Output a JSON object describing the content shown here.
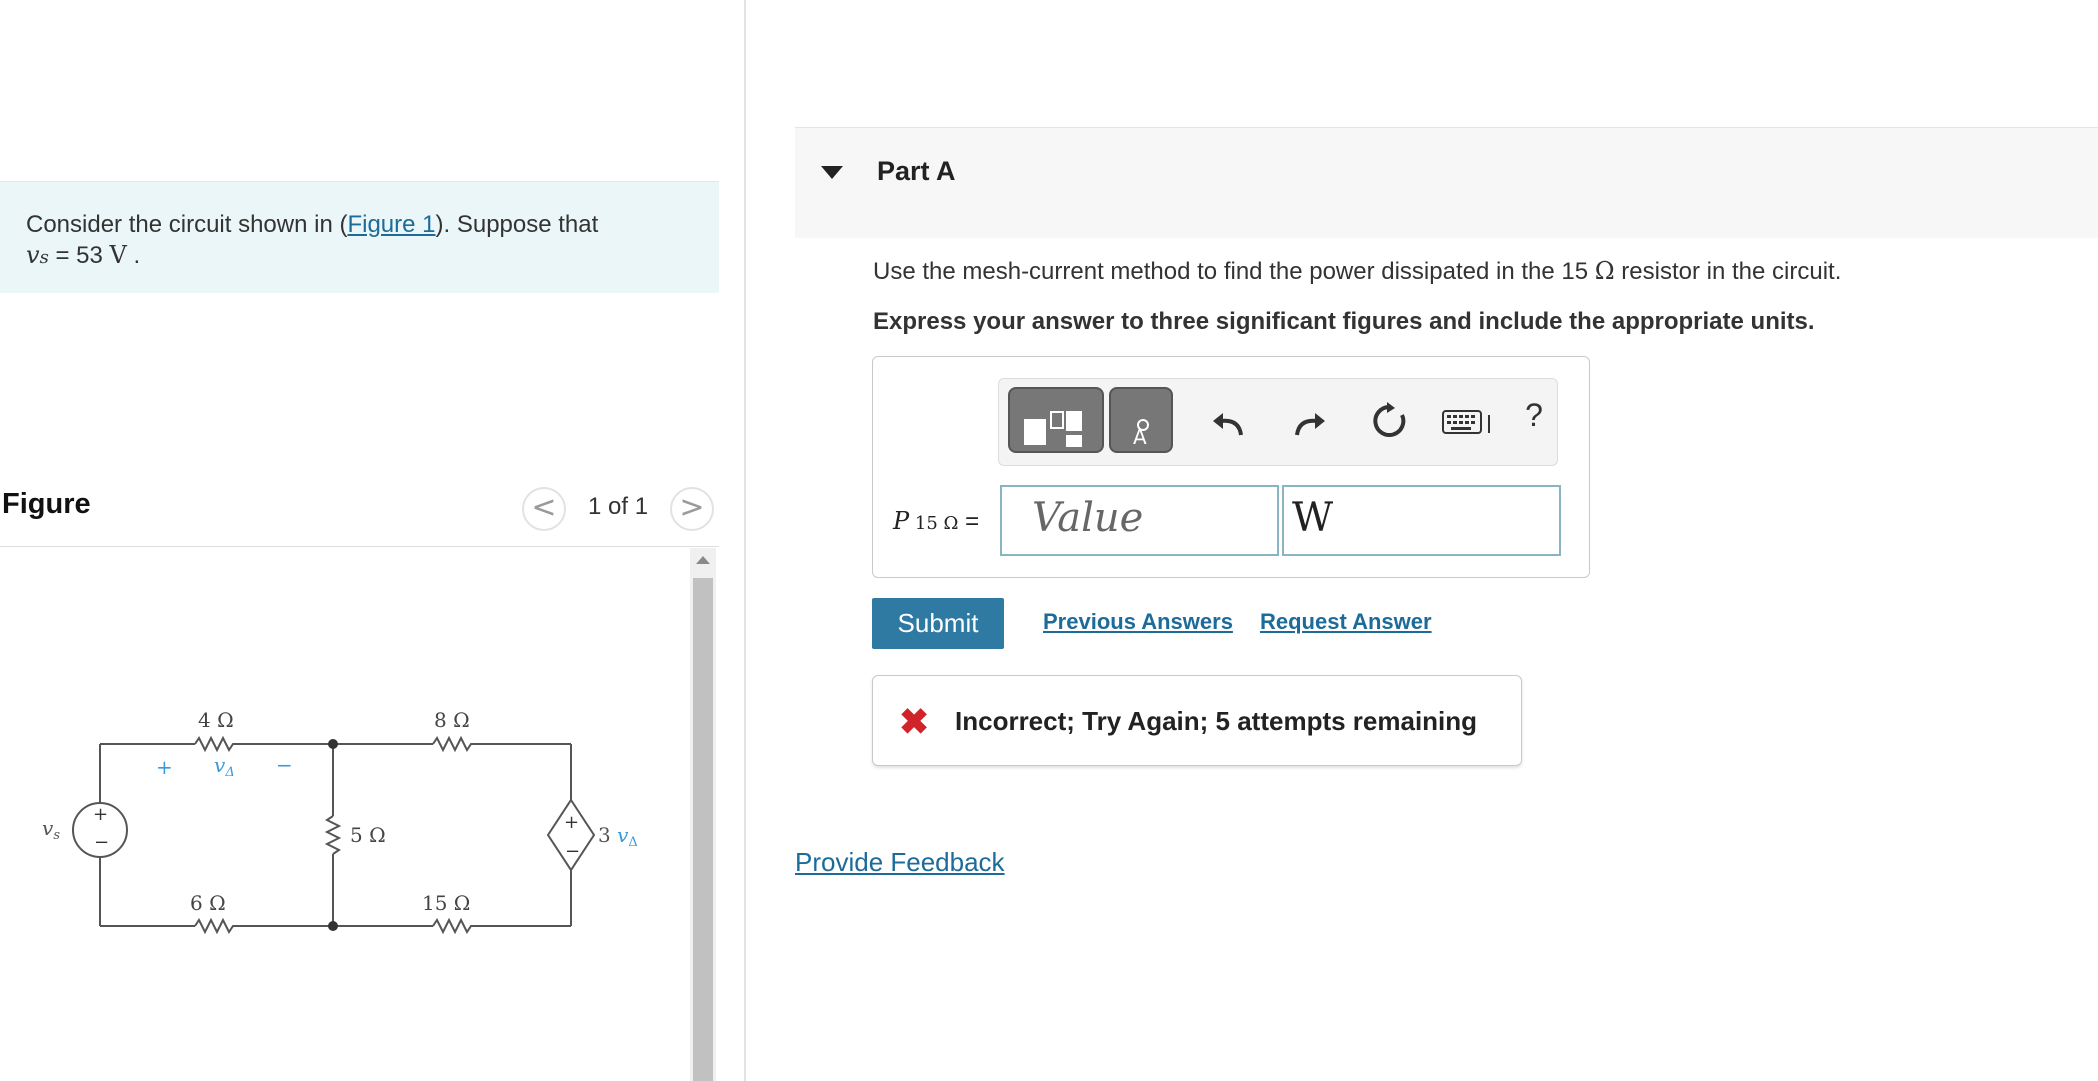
{
  "intro": {
    "text_before_link": "Consider the circuit shown in (",
    "figure_link": "Figure 1",
    "text_after_link": "). Suppose that",
    "source_symbol": "v",
    "source_subscript": "s",
    "source_equals": " = 53 ",
    "source_unit": "V",
    "period": " ."
  },
  "figure": {
    "title": "Figure",
    "counter": "1 of 1",
    "prev_glyph": "<",
    "next_glyph": ">",
    "circuit_labels": {
      "r1": "4 Ω",
      "r2": "8 Ω",
      "r3": "5 Ω",
      "r4": "6 Ω",
      "r5": "15 Ω",
      "vs": "v",
      "vs_sub": "s",
      "vdelta": "v",
      "vdelta_sub": "Δ",
      "dep_source_coef": "3 ",
      "plus": "+",
      "minus": "−"
    }
  },
  "part": {
    "title": "Part A",
    "question_before": "Use the mesh-current method to find the power dissipated in the 15 ",
    "question_omega": "Ω",
    "question_after": " resistor in the circuit.",
    "instructions": "Express your answer to three significant figures and include the appropriate units."
  },
  "answer": {
    "label_symbol": "P",
    "label_sub": " 15 Ω",
    "label_eq": " =",
    "value_placeholder": "Value",
    "units_value": "W",
    "help_label": "?"
  },
  "actions": {
    "submit": "Submit",
    "previous_answers": "Previous Answers",
    "request_answer": "Request Answer"
  },
  "feedback": {
    "icon": "✖",
    "text": "Incorrect; Try Again; 5 attempts remaining"
  },
  "footer": {
    "provide_feedback": "Provide Feedback"
  },
  "colors": {
    "accent": "#2e7aa3",
    "link": "#1c6b9a",
    "intro_bg": "#eaf6f8",
    "error": "#d0232a",
    "circuit_blue": "#3a9ad9"
  }
}
